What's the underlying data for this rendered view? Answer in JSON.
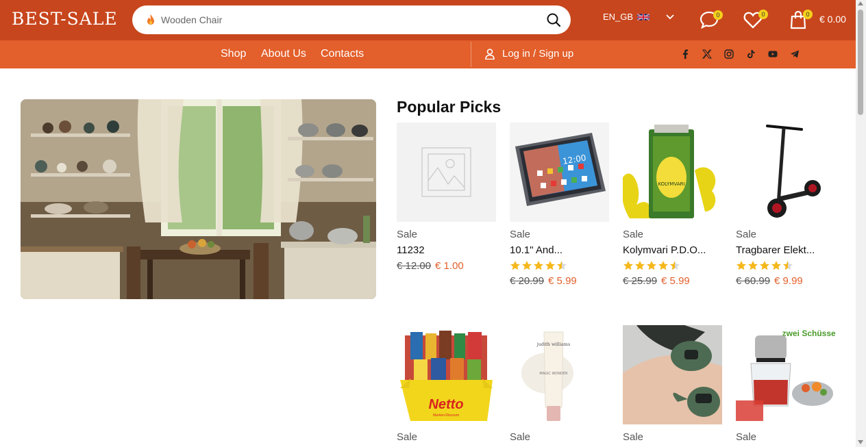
{
  "header": {
    "logo": "BEST-SALE",
    "search_placeholder": "Wooden Chair",
    "language": "EN_GB",
    "messages_count": "0",
    "wishlist_count": "0",
    "cart_count": "0",
    "cart_total": "€ 0.00"
  },
  "nav": {
    "shop": "Shop",
    "about": "About Us",
    "contacts": "Contacts",
    "login": "Log in / Sign up"
  },
  "social_icons": [
    "facebook-icon",
    "x-icon",
    "instagram-icon",
    "tiktok-icon",
    "youtube-icon",
    "telegram-icon"
  ],
  "section_title": "Popular Picks",
  "products": [
    {
      "badge": "Sale",
      "name": "11232",
      "rating": null,
      "old_price": "€ 12.00",
      "new_price": "€ 1.00"
    },
    {
      "badge": "Sale",
      "name": "10.1\" And...",
      "rating": 4.5,
      "old_price": "€ 20.99",
      "new_price": "€ 5.99"
    },
    {
      "badge": "Sale",
      "name": "Kolymvari P.D.O...",
      "rating": 4.5,
      "old_price": "€ 25.99",
      "new_price": "€ 5.99"
    },
    {
      "badge": "Sale",
      "name": "Tragbarer Elekt...",
      "rating": 4.5,
      "old_price": "€ 60.99",
      "new_price": "€ 9.99"
    },
    {
      "badge": "Sale",
      "image_text": "Netto",
      "image_subtext": "Marken-Discount"
    },
    {
      "badge": "Sale",
      "image_text": "judith williams",
      "image_subtext": "MAGIC WONDER"
    },
    {
      "badge": "Sale"
    },
    {
      "badge": "Sale",
      "image_text": "zwei Schüsseln"
    }
  ],
  "colors": {
    "topbar": "#c8461d",
    "navbar": "#e35f2b",
    "accent_price": "#e35f2b",
    "star": "#f5b81c",
    "badge": "#f4d01c"
  }
}
